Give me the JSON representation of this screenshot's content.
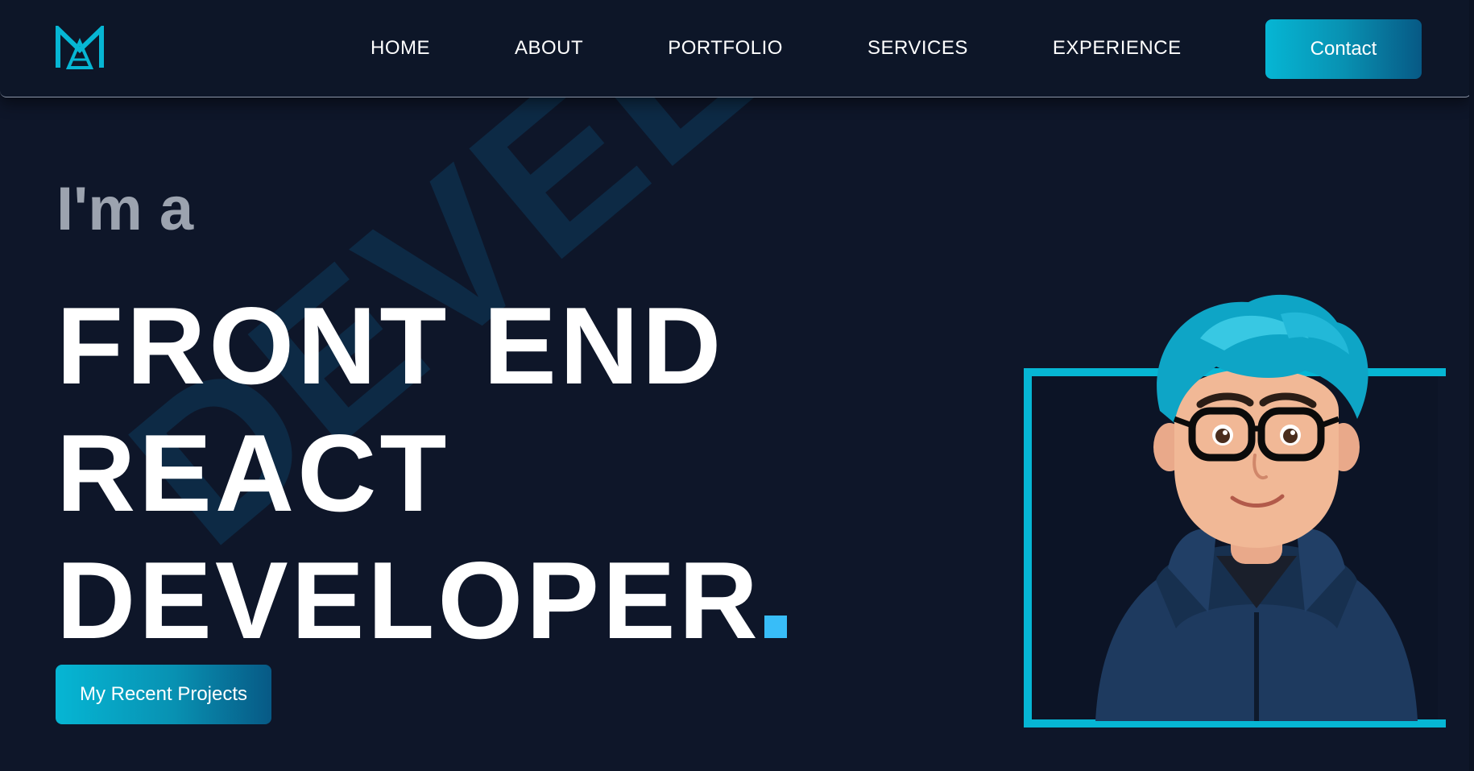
{
  "brand": {
    "logo_icon": "ma-monogram-icon",
    "accent_color": "#06b6d4",
    "background_color": "#0e1629"
  },
  "nav": {
    "items": [
      {
        "label": "HOME"
      },
      {
        "label": "ABOUT"
      },
      {
        "label": "PORTFOLIO"
      },
      {
        "label": "SERVICES"
      },
      {
        "label": "EXPERIENCE"
      }
    ],
    "contact_label": "Contact"
  },
  "hero": {
    "intro": "I'm a",
    "lines": [
      "FRONT END",
      "REACT",
      "DEVELOPER"
    ],
    "cta_label": "My Recent Projects",
    "watermark": "DEVELOPER",
    "avatar_icon": "developer-avatar-icon"
  }
}
